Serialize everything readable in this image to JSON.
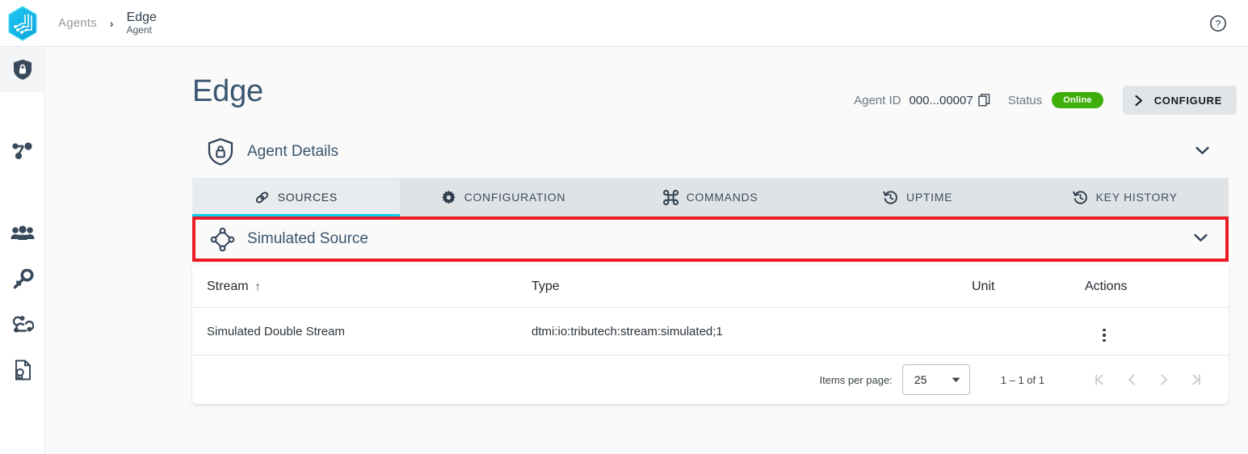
{
  "topbar": {
    "logo_icon": "hexagon-circuit-logo",
    "breadcrumb": {
      "root": "Agents",
      "separator": "›",
      "current_title": "Edge",
      "current_subtitle": "Agent"
    },
    "help_icon": "help-circle-icon"
  },
  "sidebar": {
    "items": [
      {
        "icon": "shield-lock-icon",
        "active": true
      },
      {
        "icon": "network-share-icon",
        "active": false
      },
      {
        "icon": "people-group-icon",
        "active": false
      },
      {
        "icon": "key-icon",
        "active": false
      },
      {
        "icon": "webhook-icon",
        "active": false
      },
      {
        "icon": "certificate-document-icon",
        "active": false
      }
    ]
  },
  "page": {
    "title": "Edge",
    "agent_id_label": "Agent ID",
    "agent_id_value": "000...00007",
    "copy_icon": "copy-icon",
    "status_label": "Status",
    "status_value": "Online",
    "status_color": "#3fae0b",
    "configure_label": "CONFIGURE",
    "configure_icon": "chevron-right-icon"
  },
  "agent_details": {
    "icon": "shield-lock-outline-icon",
    "title": "Agent Details",
    "chevron": "chevron-down-icon"
  },
  "tabs": [
    {
      "label": "SOURCES",
      "icon": "link-icon",
      "active": true
    },
    {
      "label": "CONFIGURATION",
      "icon": "gear-icon",
      "active": false
    },
    {
      "label": "COMMANDS",
      "icon": "command-icon",
      "active": false
    },
    {
      "label": "UPTIME",
      "icon": "history-icon",
      "active": false
    },
    {
      "label": "KEY HISTORY",
      "icon": "history-icon",
      "active": false
    }
  ],
  "tabs_accent_color": "#00d2f0",
  "source_panel": {
    "icon": "diamond-nodes-icon",
    "title": "Simulated Source",
    "chevron": "chevron-down-icon",
    "highlight_color": "#eb1c24"
  },
  "table": {
    "headers": {
      "stream": "Stream",
      "sort_indicator": "↑",
      "type": "Type",
      "unit": "Unit",
      "actions": "Actions"
    },
    "rows": [
      {
        "stream": "Simulated Double Stream",
        "type": "dtmi:io:tributech:stream:simulated;1",
        "unit": "",
        "actions_icon": "kebab-menu-icon"
      }
    ]
  },
  "paginator": {
    "items_per_page_label": "Items per page:",
    "items_per_page_value": "25",
    "dropdown_icon": "triangle-down-icon",
    "range_label": "1 – 1 of 1",
    "first_page_icon": "first-page-icon",
    "prev_page_icon": "prev-page-icon",
    "next_page_icon": "next-page-icon",
    "last_page_icon": "last-page-icon"
  }
}
